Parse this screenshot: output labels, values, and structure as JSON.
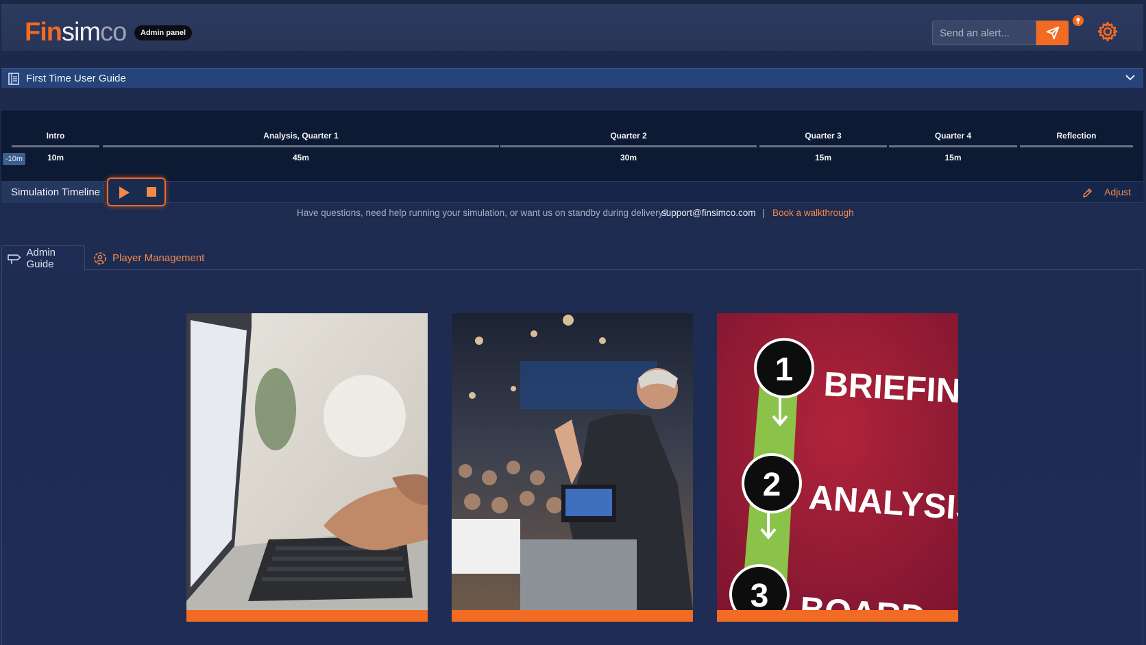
{
  "header": {
    "logo_fin": "Fin",
    "logo_sim": "sim",
    "logo_co": "co",
    "badge": "Admin panel",
    "alert_placeholder": "Send an alert...",
    "icons": [
      "send-icon",
      "pin-icon",
      "gear-icon"
    ],
    "accent_color": "#f26b22"
  },
  "guide": {
    "title": "First Time User Guide"
  },
  "timeline": {
    "offset_label": "-10m",
    "phases": [
      {
        "name": "Intro",
        "duration": "10m"
      },
      {
        "name": "Analysis, Quarter 1",
        "duration": "45m"
      },
      {
        "name": "Quarter 2",
        "duration": "30m"
      },
      {
        "name": "Quarter 3",
        "duration": "15m"
      },
      {
        "name": "Quarter 4",
        "duration": "15m"
      },
      {
        "name": "Reflection",
        "duration": ""
      }
    ],
    "sim_label": "Simulation Timeline",
    "adjust_label": "Adjust"
  },
  "help": {
    "question": "Have questions, need help running your simulation, or want us on standby during delivery?",
    "email": "support@finsimco.com",
    "separator": "|",
    "book": "Book a walkthrough"
  },
  "tabs": [
    {
      "label": "Admin Guide",
      "active": true,
      "icon": "signpost-icon"
    },
    {
      "label": "Player Management",
      "active": false,
      "icon": "user-settings-icon"
    }
  ],
  "cards": [
    {
      "image": "laptop-typing-photo"
    },
    {
      "image": "presenter-audience-photo"
    },
    {
      "image": "briefing-analysis-steps",
      "steps": [
        "1",
        "BRIEFING",
        "2",
        "ANALYSIS",
        "3",
        "BOARD"
      ]
    }
  ]
}
